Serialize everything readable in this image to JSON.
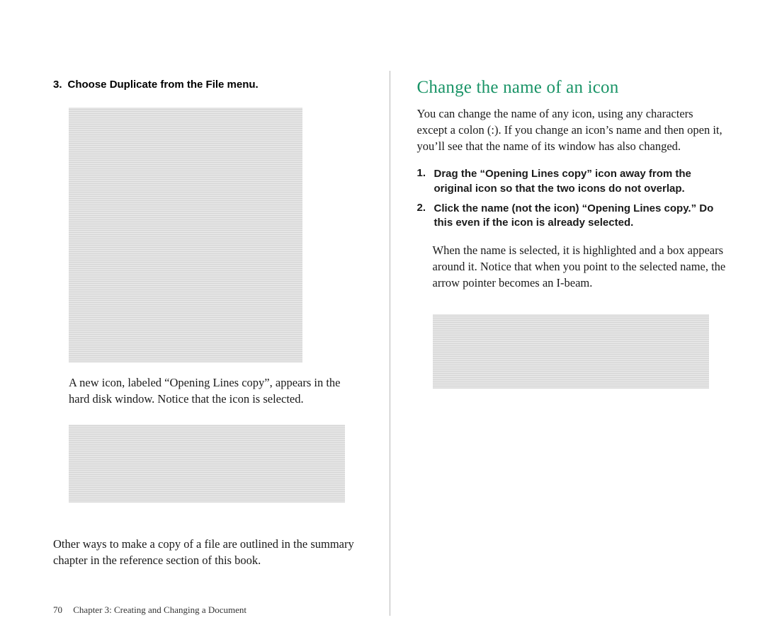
{
  "left": {
    "step3_num": "3.",
    "step3_text": "Choose Duplicate from the File menu.",
    "after_big": "A new icon, labeled “Opening Lines copy”, appears in the hard disk window. Notice that the icon is selected.",
    "closing": "Other ways to make a copy of a file are outlined in the summary chapter in the reference section of this book."
  },
  "right": {
    "heading": "Change the name of an icon",
    "intro": "You can change the name of any icon, using any characters except a colon (:). If you change an icon’s name and then open it, you’ll see that the name of its window has also changed.",
    "step1_num": "1.",
    "step1_text": "Drag the “Opening Lines copy” icon away from the original icon so that the two icons do not overlap.",
    "step2_num": "2.",
    "step2_text": "Click the name (not the icon) “Opening Lines copy.” Do this even if the icon is already selected.",
    "after_steps": "When the name is selected, it is highlighted and a box appears around it. Notice that when you point to the selected name, the arrow pointer becomes an I-beam."
  },
  "footer": {
    "page_number": "70",
    "chapter": "Chapter 3: Creating and Changing a Document"
  }
}
